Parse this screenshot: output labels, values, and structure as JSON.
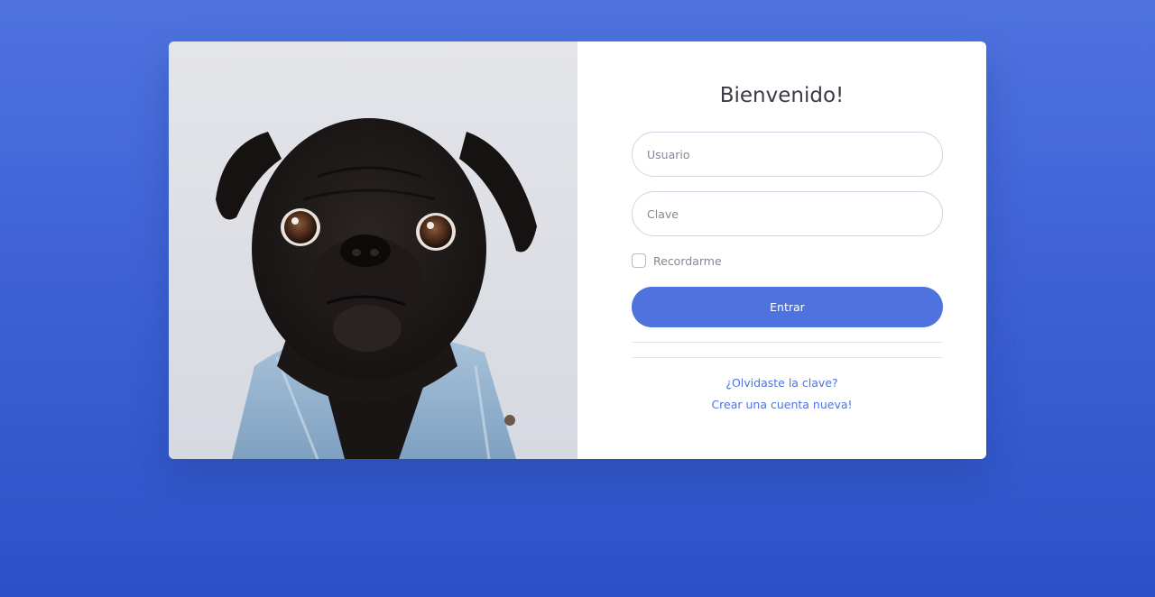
{
  "login": {
    "title": "Bienvenido!",
    "username_placeholder": "Usuario",
    "password_placeholder": "Clave",
    "remember_label": "Recordarme",
    "submit_label": "Entrar",
    "forgot_password_link": "¿Olvidaste la clave?",
    "register_link": "Crear una cuenta nueva!"
  },
  "image": {
    "subject": "pug-in-denim-jacket-photo"
  },
  "colors": {
    "primary": "#4e73df",
    "background_gradient_end": "#2a52c6",
    "card_background": "#ffffff",
    "heading_text": "#3a3b45",
    "muted_text": "#858796"
  }
}
